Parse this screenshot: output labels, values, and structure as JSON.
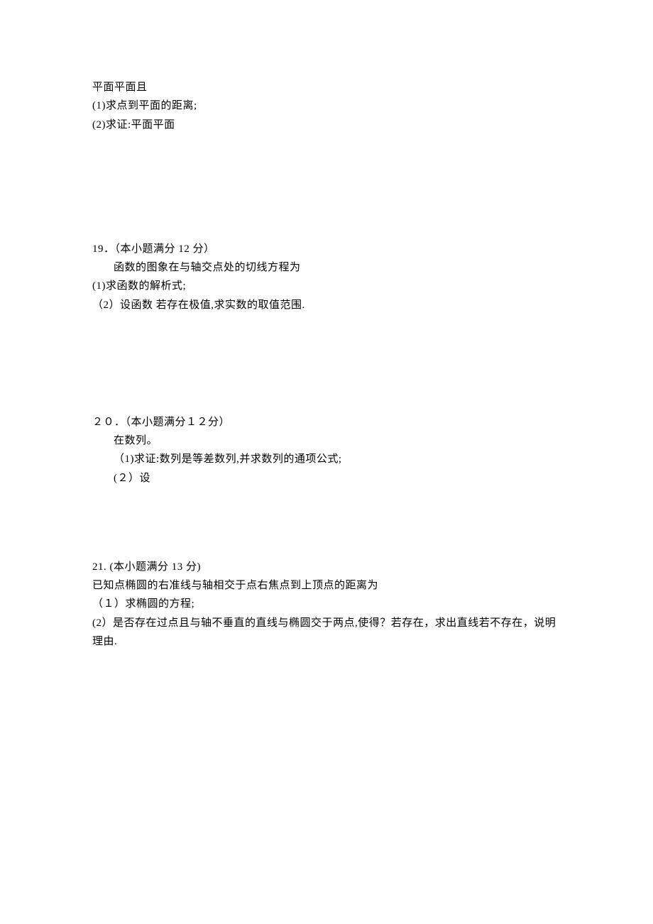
{
  "q18": {
    "line1": "平面平面且",
    "line2": "(1)求点到平面的距离;",
    "line3": "(2)求证:平面平面"
  },
  "q19": {
    "header": "19．（本小题满分 12 分）",
    "line1": "函数的图象在与轴交点处的切线方程为",
    "line2": "(1)求函数的解析式;",
    "line3": "（2）设函数   若存在极值,求实数的取值范围."
  },
  "q20": {
    "header": "２０．（本小题满分１２分）",
    "line1": "在数列。",
    "line2": "（1)求证:数列是等差数列,并求数列的通项公式;",
    "line3": "(２）设"
  },
  "q21": {
    "header": "21. (本小题满分 13 分)",
    "line1": "已知点椭圆的右准线与轴相交于点右焦点到上顶点的距离为",
    "line2": "（１）求椭圆的方程;",
    "line3": "(2）是否存在过点且与轴不垂直的直线与椭圆交于两点,使得？若存在，求出直线若不存在，说明理由."
  }
}
